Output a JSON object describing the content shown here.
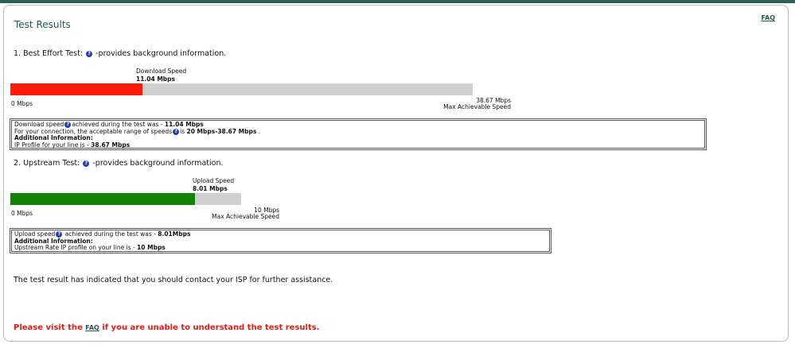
{
  "page": {
    "title": "Test Results",
    "faq_link": "FAQ"
  },
  "best_effort": {
    "heading_prefix": "1. Best Effort Test:",
    "heading_suffix": "-provides background information.",
    "speed_caption": "Download Speed",
    "speed_value": "11.04 Mbps",
    "min_label": "0 Mbps",
    "max_value": "38.67 Mbps",
    "max_caption": "Max Achievable Speed",
    "fill_fraction": 0.2855,
    "fill_color": "#ff1a0a",
    "info": {
      "line1_prefix": "Download speed",
      "line1_middle": "achieved during the test was - ",
      "line1_value": "11.04 Mbps",
      "line2_prefix": "For your connection, the acceptable range of speeds",
      "line2_middle": "is ",
      "line2_value": "20 Mbps-38.67 Mbps",
      "line2_suffix": " .",
      "line3": "Additional Information:",
      "line4_prefix": "IP Profile for your line is - ",
      "line4_value": "38.67 Mbps"
    }
  },
  "upstream": {
    "heading_prefix": "2. Upstream Test:",
    "heading_suffix": "-provides background information.",
    "speed_caption": "Upload Speed",
    "speed_value": "8.01 Mbps",
    "min_label": "0 Mbps",
    "max_value": "10 Mbps",
    "max_caption": "Max Achievable Speed",
    "fill_fraction": 0.801,
    "fill_color": "#138008",
    "info": {
      "line1_prefix": "Upload speed",
      "line1_middle": " achieved during the test was - ",
      "line1_value": "8.01Mbps",
      "line2": "Additional Information:",
      "line3_prefix": "Upstream Rate IP profile on your line is - ",
      "line3_value": "10 Mbps"
    }
  },
  "messages": {
    "contact": "The test result has indicated that you should contact your ISP for further assistance.",
    "visit_prefix": "Please visit the ",
    "visit_link": "FAQ",
    "visit_suffix": " if you are unable to understand the test results."
  }
}
